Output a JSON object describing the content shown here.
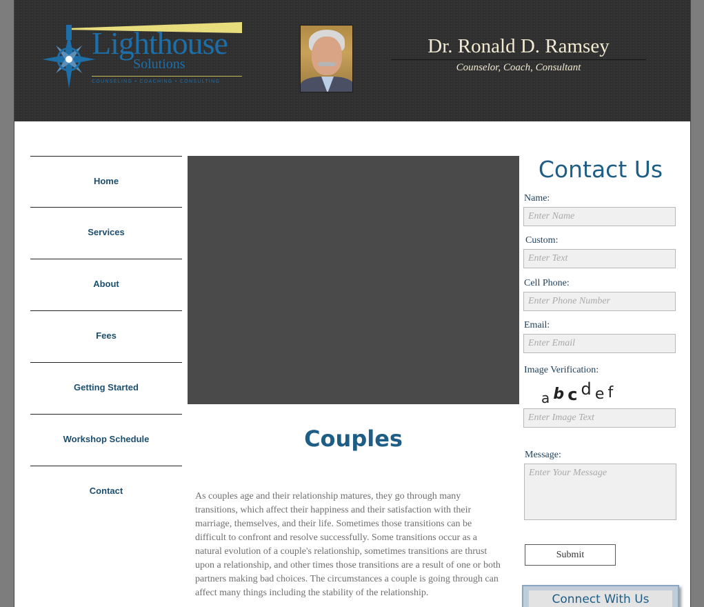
{
  "header": {
    "logo_name": "Lighthouse",
    "logo_sub": "Solutions",
    "logo_tagline": "COUNSELING • COACHING • CONSULTING",
    "doctor_name": "Dr. Ronald D. Ramsey",
    "doctor_title": "Counselor, Coach, Consultant"
  },
  "nav": {
    "items": [
      {
        "label": "Home"
      },
      {
        "label": "Services"
      },
      {
        "label": "About"
      },
      {
        "label": "Fees"
      },
      {
        "label": "Getting Started"
      },
      {
        "label": "Workshop Schedule"
      },
      {
        "label": "Contact"
      }
    ]
  },
  "main": {
    "title": "Couples",
    "body": "As couples age and their relationship matures, they go through many transitions, which affect their happiness and their satisfaction with their marriage, themselves, and their life.  Sometimes those transitions can be difficult to confront and resolve successfully.  Some transitions occur as a natural evolution of a couple's relationship, sometimes transitions are thrust upon a relationship, and other times those transitions are a result of one or both partners making bad choices.  The circumstances a couple is going through can affect many things including the stability of the relationship."
  },
  "contact": {
    "title": "Contact Us",
    "name_label": "Name:",
    "name_placeholder": "Enter Name",
    "custom_label": "Custom:",
    "custom_placeholder": "Enter Text",
    "phone_label": "Cell Phone:",
    "phone_placeholder": "Enter Phone Number",
    "email_label": "Email:",
    "email_placeholder": "Enter Email",
    "verify_label": "Image Verification:",
    "captcha_chars": [
      "a",
      "b",
      "c",
      "d",
      "e",
      "f"
    ],
    "verify_placeholder": "Enter Image Text",
    "message_label": "Message:",
    "message_placeholder": "Enter Your Message",
    "submit_label": "Submit",
    "connect_label": "Connect With Us"
  }
}
